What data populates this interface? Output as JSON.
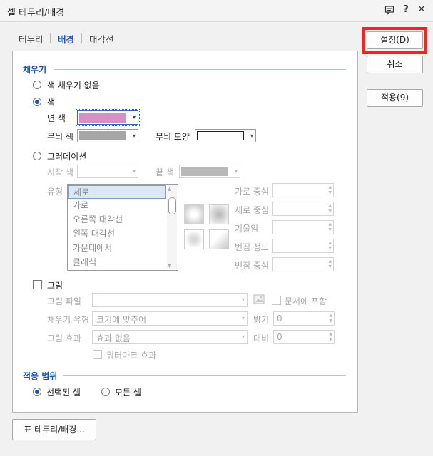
{
  "window": {
    "title": "셀 테두리/배경"
  },
  "tabs": [
    {
      "label": "테두리"
    },
    {
      "label": "배경"
    },
    {
      "label": "대각선"
    }
  ],
  "buttons": {
    "ok": "설정(D)",
    "cancel": "취소",
    "apply": "적용(9)",
    "table_border": "표 테두리/배경..."
  },
  "fill": {
    "section": "채우기",
    "no_fill": "색 채우기 없음",
    "color": "색",
    "face_color": "면 색",
    "face_color_value": "#d88fc6",
    "pattern_color": "무늬 색",
    "pattern_color_value": "#a6a6a6",
    "pattern_shape": "무늬 모양",
    "gradient": "그러데이션",
    "start_color": "시작 색",
    "end_color": "끝 색",
    "type": "유형",
    "types": [
      "세로",
      "가로",
      "오른쪽 대각선",
      "왼쪽 대각선",
      "가운데에서",
      "클래식"
    ],
    "h_center": "가로 중심",
    "v_center": "세로 중심",
    "tilt": "기울임",
    "blur_degree": "번짐 정도",
    "blur_center": "번짐 중심"
  },
  "picture": {
    "label": "그림",
    "file": "그림 파일",
    "include_in_doc": "문서에 포함",
    "fill_type": "채우기 유형",
    "fill_type_value": "크기에 맞추어",
    "brightness": "밝기",
    "brightness_value": "0",
    "effect": "그림 효과",
    "effect_value": "효과 없음",
    "contrast": "대비",
    "contrast_value": "0",
    "watermark": "워터마크 효과"
  },
  "scope": {
    "section": "적용 범위",
    "selected": "선택된 셀",
    "all": "모든 셀"
  },
  "icons": {
    "help": "?",
    "close": "✕",
    "arrow": "▾"
  }
}
